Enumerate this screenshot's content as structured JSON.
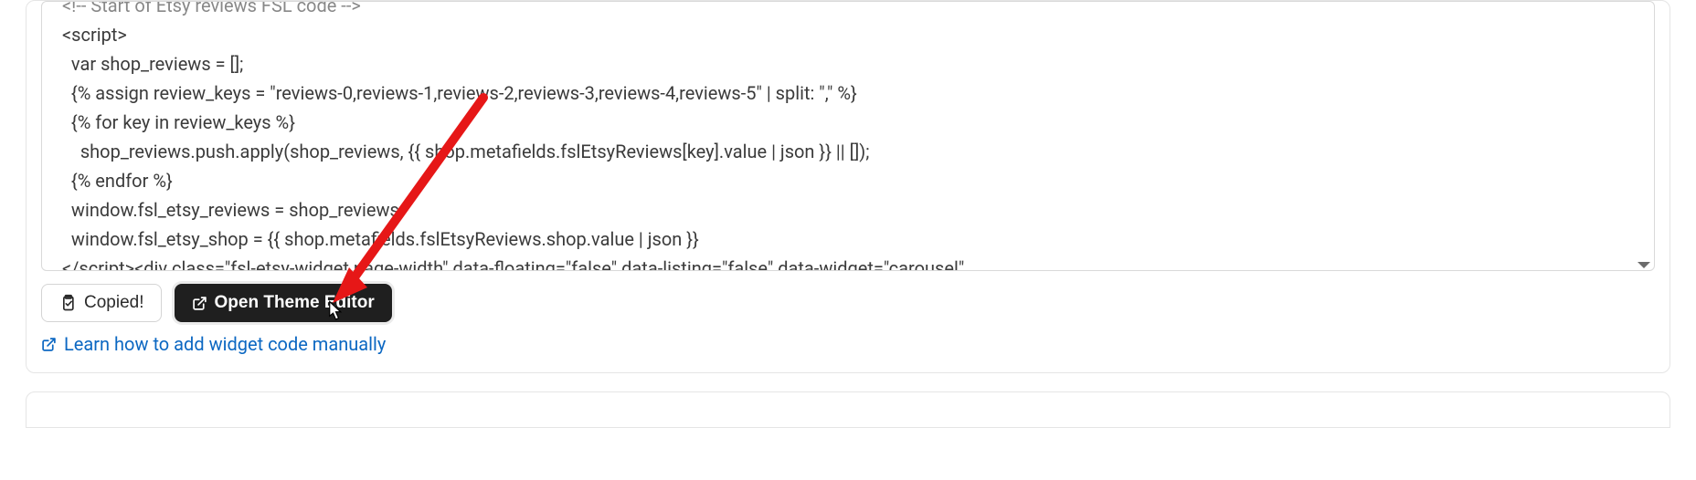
{
  "code": {
    "lines": [
      "<!-- Start of Etsy reviews FSL code -->",
      "<script>",
      "  var shop_reviews = [];",
      "  {% assign review_keys = \"reviews-0,reviews-1,reviews-2,reviews-3,reviews-4,reviews-5\" | split: \",\" %}",
      "  {% for key in review_keys %}",
      "    shop_reviews.push.apply(shop_reviews, {{ shop.metafields.fslEtsyReviews[key].value | json }} || []);",
      "  {% endfor %}",
      "  window.fsl_etsy_reviews = shop_reviews;",
      "  window.fsl_etsy_shop = {{ shop.metafields.fslEtsyReviews.shop.value | json }}",
      "</script><div class=\"fsl-etsy-widget page-width\" data-floating=\"false\" data-listing=\"false\" data-widget=\"carousel\""
    ]
  },
  "buttons": {
    "copied": "Copied!",
    "open_theme_editor": "Open Theme Editor"
  },
  "links": {
    "learn_manual": "Learn how to add widget code manually"
  }
}
